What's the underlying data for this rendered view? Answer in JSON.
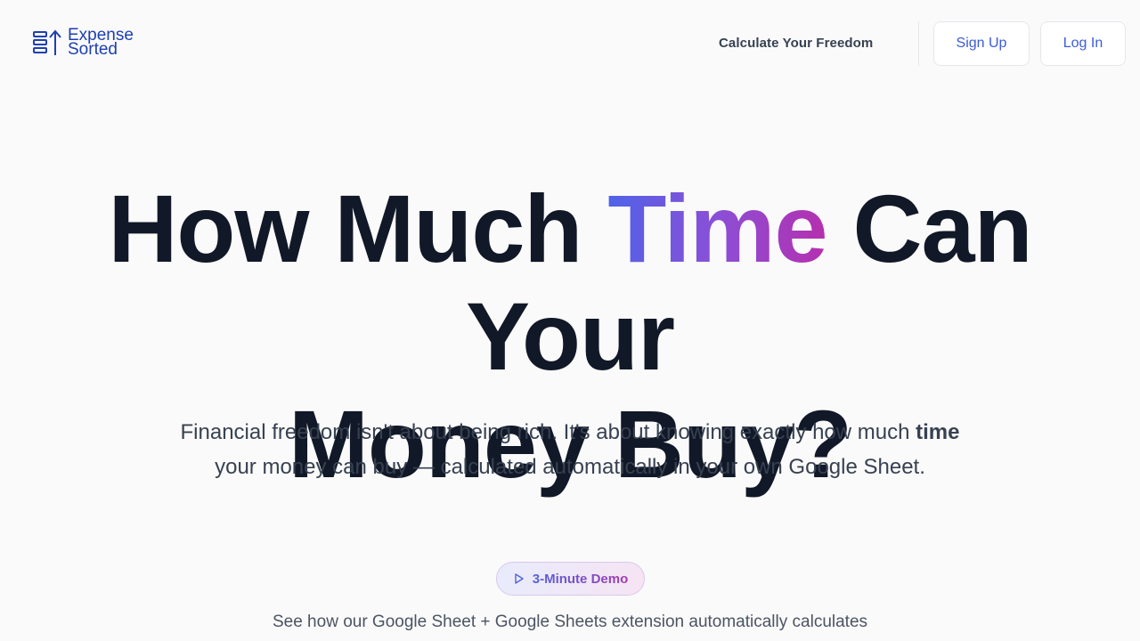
{
  "header": {
    "logo": {
      "line1": "Expense",
      "line2": "Sorted",
      "icon": "logo-bars-arrow-icon"
    },
    "nav": {
      "calculate_label": "Calculate Your Freedom"
    },
    "buttons": {
      "signup_label": "Sign Up",
      "login_label": "Log In"
    }
  },
  "hero": {
    "title_part1": "How Much ",
    "title_highlight": "Time",
    "title_part2": " Can Your",
    "title_line2": "Money Buy?",
    "subtitle_part1": "Financial freedom isn't about being rich. It's about knowing exactly how much ",
    "subtitle_bold": "time",
    "subtitle_part2": " your money can buy — calculated automatically in your own Google Sheet.",
    "demo_pill": {
      "label": "3-Minute Demo",
      "icon": "play-icon"
    },
    "demo_description": "See how our Google Sheet + Google Sheets extension automatically calculates"
  },
  "colors": {
    "accent": "#3b5bdb",
    "gradient_start": "#4f63e8",
    "gradient_end": "#b52fae",
    "heading": "#111827"
  }
}
